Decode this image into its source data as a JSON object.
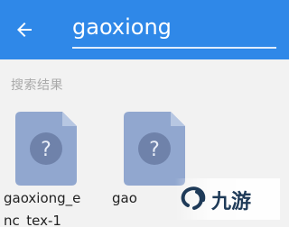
{
  "header": {
    "back_icon": "arrow-left-icon",
    "search_value": "gaoxiong"
  },
  "results": {
    "section_label": "搜索结果",
    "files": [
      {
        "name_line1": "gaoxiong_e",
        "name_line2": "nc_tex-1",
        "icon": "unknown-file-icon"
      },
      {
        "name_line1": "gao",
        "icon": "unknown-file-icon"
      }
    ]
  },
  "watermark": {
    "text": "九游"
  }
}
